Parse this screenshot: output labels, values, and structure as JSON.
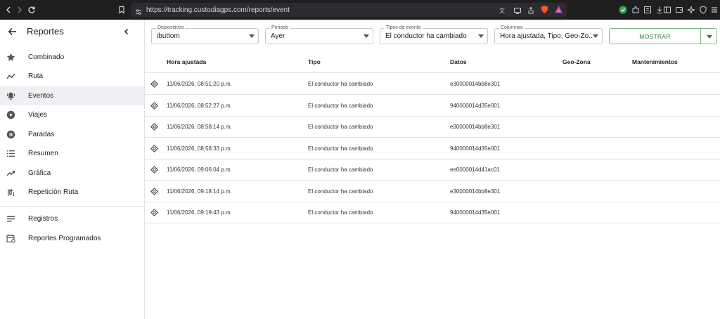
{
  "browser": {
    "url": "https://tracking.custodiagps.com/reports/event"
  },
  "sidebar": {
    "title": "Reportes",
    "items": [
      {
        "label": "Combinado",
        "icon": "star-icon"
      },
      {
        "label": "Ruta",
        "icon": "timeline-icon"
      },
      {
        "label": "Eventos",
        "icon": "bell-icon"
      },
      {
        "label": "Viajes",
        "icon": "play-circle-icon"
      },
      {
        "label": "Paradas",
        "icon": "pause-circle-icon"
      },
      {
        "label": "Resumen",
        "icon": "list-icon"
      },
      {
        "label": "Gráfica",
        "icon": "trending-icon"
      },
      {
        "label": "Repetición Ruta",
        "icon": "replay-route-icon"
      }
    ],
    "secondary_items": [
      {
        "label": "Registros",
        "icon": "notes-icon"
      },
      {
        "label": "Reportes Programados",
        "icon": "event-repeat-icon"
      }
    ]
  },
  "filters": {
    "devices": {
      "label": "Dispositivos",
      "value": "ibuttom"
    },
    "period": {
      "label": "Periodo",
      "value": "Ayer"
    },
    "event_types": {
      "label": "Tipos de evento",
      "value": "El conductor ha cambiado"
    },
    "columns": {
      "label": "Columnas",
      "value": "Hora ajustada, Tipo, Geo-Zo..."
    },
    "show_label": "MOSTRAR"
  },
  "table": {
    "headers": [
      "Hora ajustada",
      "Tipo",
      "Datos",
      "Geo-Zona",
      "Mantenimientos"
    ],
    "rows": [
      {
        "time": "11/06/2026, 08:51:20 p.m.",
        "type": "El conductor ha cambiado",
        "data": "e30000014bb8e301",
        "geozone": "",
        "maintenance": ""
      },
      {
        "time": "11/06/2026, 08:52:27 p.m.",
        "type": "El conductor ha cambiado",
        "data": "940000014d35e001",
        "geozone": "",
        "maintenance": ""
      },
      {
        "time": "11/06/2026, 08:58:14 p.m.",
        "type": "El conductor ha cambiado",
        "data": "e30000014bb8e301",
        "geozone": "",
        "maintenance": ""
      },
      {
        "time": "11/06/2026, 08:58:33 p.m.",
        "type": "El conductor ha cambiado",
        "data": "940000014d35e001",
        "geozone": "",
        "maintenance": ""
      },
      {
        "time": "11/06/2026, 09:06:04 p.m.",
        "type": "El conductor ha cambiado",
        "data": "ee0000014d41ac01",
        "geozone": "",
        "maintenance": ""
      },
      {
        "time": "11/06/2026, 09:18:14 p.m.",
        "type": "El conductor ha cambiado",
        "data": "e30000014bb8e301",
        "geozone": "",
        "maintenance": ""
      },
      {
        "time": "11/06/2026, 09:19:43 p.m.",
        "type": "El conductor ha cambiado",
        "data": "940000014d35e001",
        "geozone": "",
        "maintenance": ""
      }
    ]
  },
  "colors": {
    "accent_green": "#2e7d32",
    "active_bg": "#eef0f3",
    "chrome_bg": "#1f1f22"
  }
}
